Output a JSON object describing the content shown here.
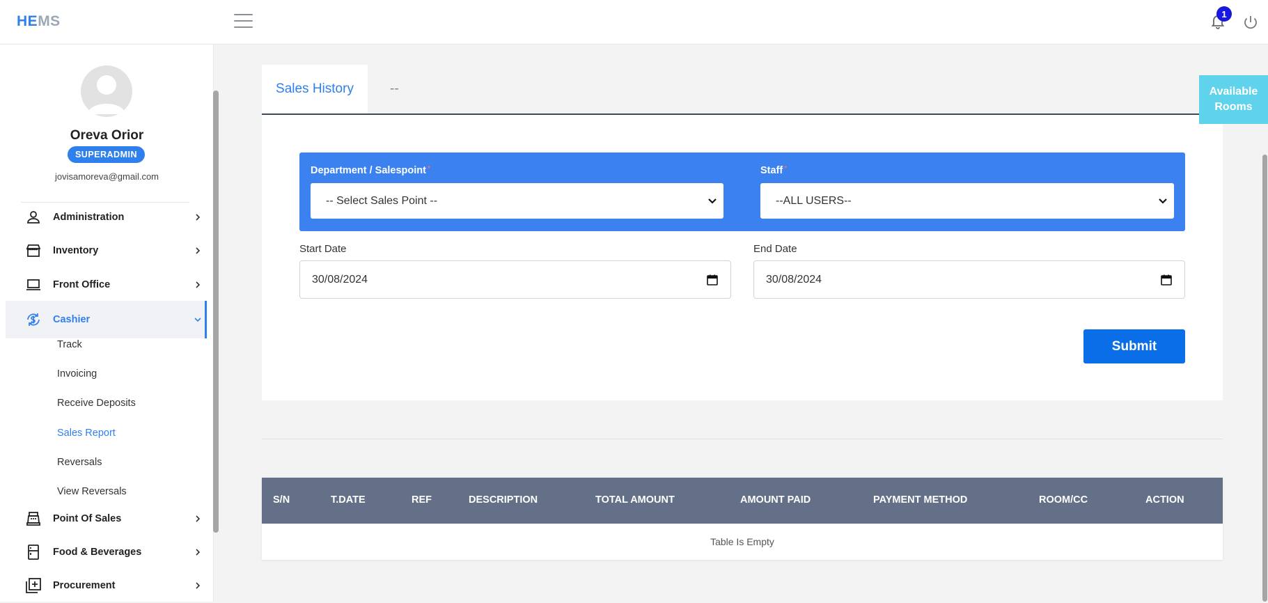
{
  "topbar": {
    "logo_he": "HE",
    "logo_ms": "MS",
    "notification_count": "1",
    "icons": [
      "hamburger-icon",
      "bell-icon",
      "power-icon"
    ]
  },
  "sidebar": {
    "user_name": "Oreva Orior",
    "role": "SUPERADMIN",
    "email": "jovisamoreva@gmail.com",
    "items": [
      {
        "label": "Administration",
        "icon": "user-icon"
      },
      {
        "label": "Inventory",
        "icon": "store-icon"
      },
      {
        "label": "Front Office",
        "icon": "laptop-icon"
      },
      {
        "label": "Cashier",
        "icon": "cashier-icon",
        "expanded": true
      },
      {
        "label": "Point Of Sales",
        "icon": "pos-icon"
      },
      {
        "label": "Food & Beverages",
        "icon": "fridge-icon"
      },
      {
        "label": "Procurement",
        "icon": "add-box-icon"
      }
    ],
    "cashier_sub": [
      "Track",
      "Invoicing",
      "Receive Deposits",
      "Sales Report",
      "Reversals",
      "View Reversals"
    ],
    "active_sub": "Sales Report"
  },
  "tabs": {
    "active": "Sales History",
    "other": "--"
  },
  "form": {
    "department_label": "Department / Salespoint",
    "department_value": "-- Select Sales Point --",
    "staff_label": "Staff",
    "staff_value": "--ALL USERS--",
    "start_label": "Start Date",
    "start_value": "30/08/2024",
    "end_label": "End Date",
    "end_value": "30/08/2024",
    "submit_label": "Submit"
  },
  "table": {
    "columns": [
      "S/N",
      "T.DATE",
      "REF",
      "DESCRIPTION",
      "TOTAL AMOUNT",
      "AMOUNT PAID",
      "PAYMENT METHOD",
      "ROOM/CC",
      "ACTION"
    ],
    "empty_message": "Table Is Empty"
  },
  "available_rooms": "Available Rooms",
  "colors": {
    "accent": "#2f80ed",
    "panel_blue": "#3b82f0",
    "submit_blue": "#0a6ee8",
    "table_header": "#637087",
    "available_rooms": "#5fd3ec"
  }
}
